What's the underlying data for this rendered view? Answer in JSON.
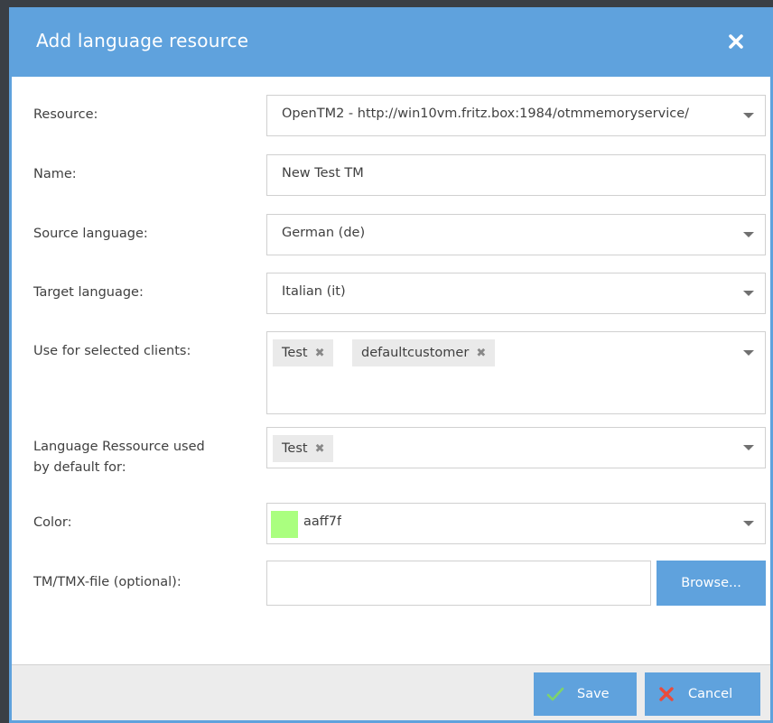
{
  "dialog": {
    "title": "Add language resource",
    "close_icon": "close-icon"
  },
  "form": {
    "resource": {
      "label": "Resource:",
      "value": "OpenTM2 - http://win10vm.fritz.box:1984/otmmemoryservice/"
    },
    "name": {
      "label": "Name:",
      "value": "New Test TM"
    },
    "source_language": {
      "label": "Source language:",
      "value": "German (de)"
    },
    "target_language": {
      "label": "Target language:",
      "value": "Italian (it)"
    },
    "clients": {
      "label": "Use for selected clients:",
      "tags": [
        "Test",
        "defaultcustomer"
      ]
    },
    "default_for": {
      "label_line1": "Language Ressource used",
      "label_line2": "by default for:",
      "tags": [
        "Test"
      ]
    },
    "color": {
      "label": "Color:",
      "value": "aaff7f",
      "swatch": "#aaff7f"
    },
    "file": {
      "label": "TM/TMX-file (optional):",
      "value": "",
      "browse_label": "Browse..."
    }
  },
  "footer": {
    "save_label": "Save",
    "cancel_label": "Cancel"
  },
  "colors": {
    "accent": "#5fa2dd",
    "save_icon": "#5cb85c",
    "cancel_icon": "#e94b3c"
  }
}
